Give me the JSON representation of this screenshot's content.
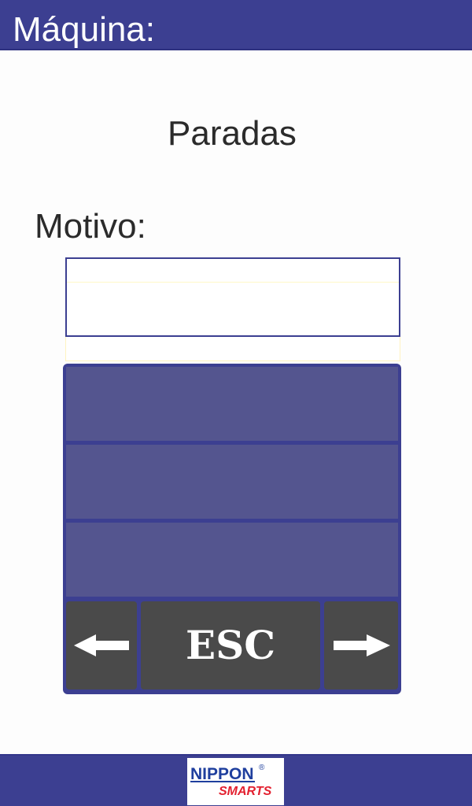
{
  "header": {
    "title": "Máquina:"
  },
  "page": {
    "title": "Paradas"
  },
  "motivo": {
    "label": "Motivo:",
    "value": ""
  },
  "options": [
    {
      "label": ""
    },
    {
      "label": ""
    },
    {
      "label": ""
    }
  ],
  "nav": {
    "prev_icon": "arrow-left-icon",
    "esc_label": "ESC",
    "next_icon": "arrow-right-icon"
  },
  "footer": {
    "logo_text_top": "NIPPON",
    "logo_text_bottom": "SMARTS",
    "logo_mark": "®"
  },
  "colors": {
    "primary": "#3c3f91",
    "option_fill": "#54558f",
    "nav_button": "#4a4a4a",
    "text": "#2b2b2b",
    "logo_blue": "#1f3f9e",
    "logo_red": "#e3202f"
  }
}
